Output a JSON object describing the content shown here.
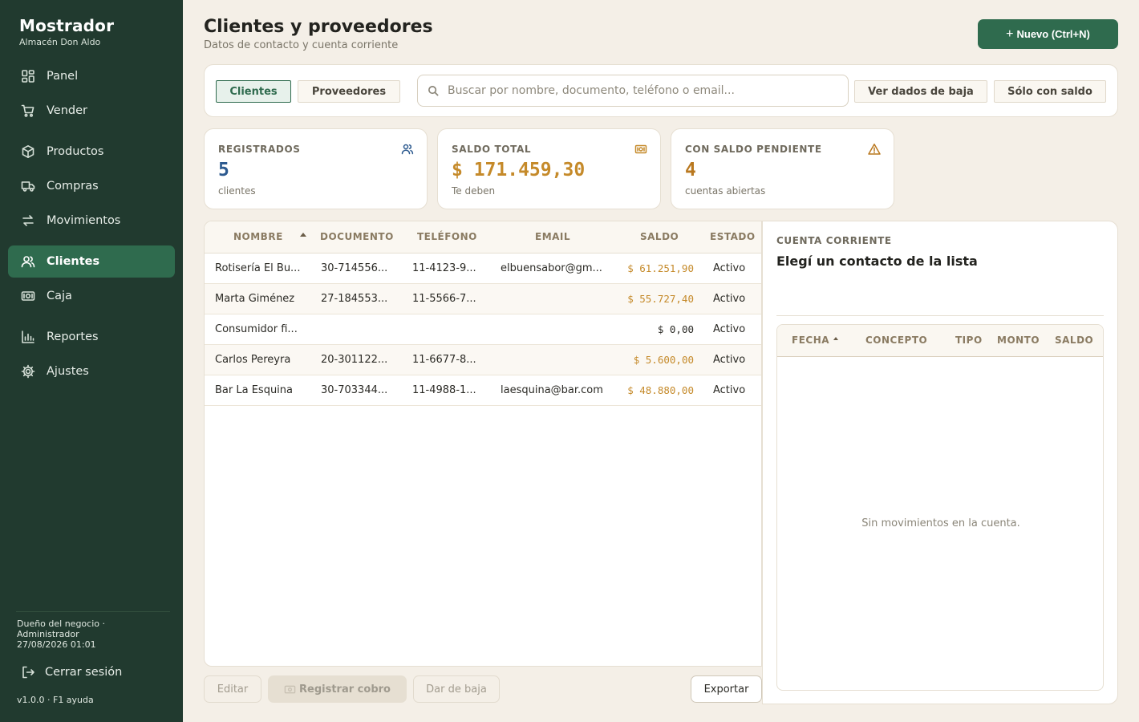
{
  "app": {
    "brand": "Mostrador",
    "store": "Almacén Don Aldo"
  },
  "sidebar": {
    "items": [
      {
        "label": "Panel",
        "icon": "dashboard-icon"
      },
      {
        "label": "Vender",
        "icon": "cart-icon"
      },
      {
        "label": "Productos",
        "icon": "box-icon"
      },
      {
        "label": "Compras",
        "icon": "truck-icon"
      },
      {
        "label": "Movimientos",
        "icon": "swap-icon"
      },
      {
        "label": "Clientes",
        "icon": "users-icon",
        "active": true
      },
      {
        "label": "Caja",
        "icon": "cash-icon"
      },
      {
        "label": "Reportes",
        "icon": "chart-icon"
      },
      {
        "label": "Ajustes",
        "icon": "gear-icon"
      }
    ],
    "user_line1": "Dueño del negocio  ·",
    "user_line2": "Administrador",
    "datetime": "27/08/2026  01:01",
    "logout": "Cerrar sesión",
    "footer": "v1.0.0  ·  F1 ayuda"
  },
  "header": {
    "title": "Clientes y proveedores",
    "subtitle": "Datos de contacto y cuenta corriente",
    "new_button": "Nuevo  (Ctrl+N)"
  },
  "filters": {
    "tab_clientes": "Clientes",
    "tab_proveedores": "Proveedores",
    "search_placeholder": "Buscar por nombre, documento, teléfono o email...",
    "ver_bajas": "Ver dados de baja",
    "solo_saldo": "Sólo con saldo"
  },
  "stats": {
    "registrados": {
      "label": "REGISTRADOS",
      "value": "5",
      "note": "clientes"
    },
    "saldo_total": {
      "label": "SALDO TOTAL",
      "value": "$ 171.459,30",
      "note": "Te deben"
    },
    "pendiente": {
      "label": "CON SALDO PENDIENTE",
      "value": "4",
      "note": "cuentas abiertas"
    }
  },
  "table": {
    "columns": {
      "nombre": "NOMBRE",
      "documento": "DOCUMENTO",
      "telefono": "TELÉFONO",
      "email": "EMAIL",
      "saldo": "SALDO",
      "estado": "ESTADO"
    },
    "rows": [
      {
        "nombre": "Rotisería El Bu...",
        "documento": "30-714556...",
        "telefono": "11-4123-9...",
        "email": "elbuensabor@gm...",
        "saldo": "$ 61.251,90",
        "estado": "Activo",
        "has_debt": true
      },
      {
        "nombre": "Marta Giménez",
        "documento": "27-184553...",
        "telefono": "11-5566-7...",
        "email": "",
        "saldo": "$ 55.727,40",
        "estado": "Activo",
        "has_debt": true
      },
      {
        "nombre": "Consumidor fi...",
        "documento": "",
        "telefono": "",
        "email": "",
        "saldo": "$ 0,00",
        "estado": "Activo",
        "has_debt": false
      },
      {
        "nombre": "Carlos Pereyra",
        "documento": "20-301122...",
        "telefono": "11-6677-8...",
        "email": "",
        "saldo": "$ 5.600,00",
        "estado": "Activo",
        "has_debt": true
      },
      {
        "nombre": "Bar La Esquina",
        "documento": "30-703344...",
        "telefono": "11-4988-1...",
        "email": "laesquina@bar.com",
        "saldo": "$ 48.880,00",
        "estado": "Activo",
        "has_debt": true
      }
    ]
  },
  "actions": {
    "editar": "Editar",
    "registrar_cobro": "Registrar cobro",
    "dar_baja": "Dar de baja",
    "exportar": "Exportar"
  },
  "cuenta": {
    "label": "CUENTA CORRIENTE",
    "title": "Elegí un contacto de la lista",
    "columns": {
      "fecha": "FECHA",
      "concepto": "CONCEPTO",
      "tipo": "TIPO",
      "monto": "MONTO",
      "saldo": "SALDO"
    },
    "empty": "Sin movimientos en la cuenta."
  },
  "colors": {
    "sidebar_bg": "#213a2f",
    "accent": "#2f6b4e",
    "money_debt": "#c58a2a",
    "count_blue": "#2d5a8f",
    "amber": "#b9781f"
  }
}
